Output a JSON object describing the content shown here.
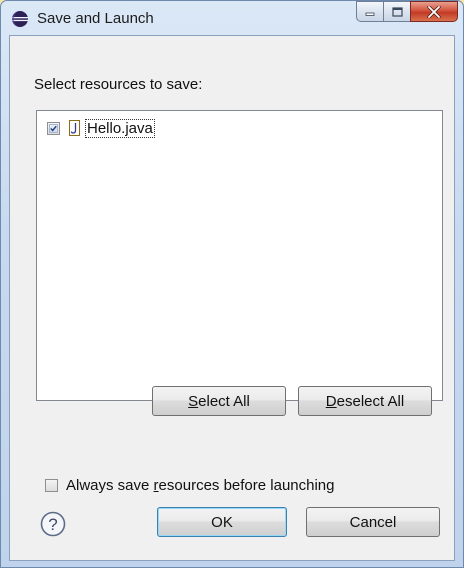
{
  "window": {
    "title": "Save and Launch",
    "controls": {
      "minimize": "minimize",
      "maximize": "maximize",
      "close": "close"
    }
  },
  "prompt": "Select resources to save:",
  "resources": [
    {
      "name": "Hello.java",
      "checked": true,
      "icon": "java-file-icon"
    }
  ],
  "buttons": {
    "select_all": {
      "pre": "",
      "key": "S",
      "post": "elect All"
    },
    "deselect_all": {
      "pre": "",
      "key": "D",
      "post": "eselect All"
    },
    "ok": "OK",
    "cancel": "Cancel"
  },
  "always_save": {
    "pre": "Always save ",
    "key": "r",
    "post": "esources before launching",
    "checked": false
  },
  "icons": {
    "title": "eclipse-icon",
    "help": "help-icon"
  },
  "colors": {
    "close_button": "#c23a24",
    "default_button_border": "#3c7fb1"
  }
}
